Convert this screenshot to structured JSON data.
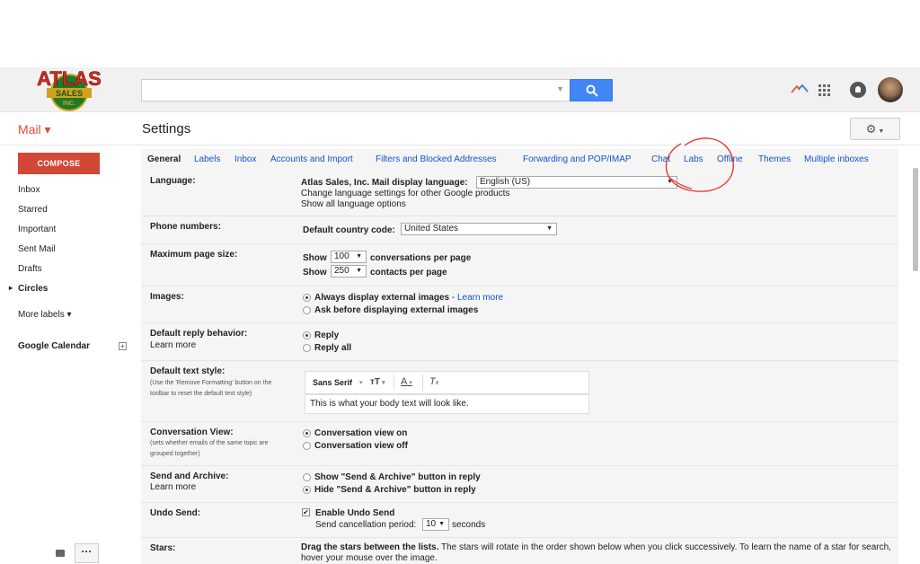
{
  "brand": {
    "logo_text": "ATLAS",
    "logo_sub": "SALES",
    "logo_inc": "INC."
  },
  "app": {
    "mail_label": "Mail ▾",
    "page_title": "Settings"
  },
  "search": {
    "placeholder": ""
  },
  "sidebar": {
    "compose_label": "COMPOSE",
    "items": [
      "Inbox",
      "Starred",
      "Important",
      "Sent Mail",
      "Drafts",
      "Circles"
    ],
    "more_labels": "More labels ▾",
    "calendar": "Google Calendar",
    "more_btn": "···"
  },
  "tabs": [
    "General",
    "Labels",
    "Inbox",
    "Accounts and Import",
    "Filters and Blocked Addresses",
    "Forwarding and POP/IMAP",
    "Chat",
    "Labs",
    "Offline",
    "Themes",
    "Multiple inboxes"
  ],
  "settings": {
    "language": {
      "label": "Language:",
      "prompt": "Atlas Sales, Inc. Mail display language:",
      "value": "English (US)",
      "link1": "Change language settings for other Google products",
      "link2": "Show all language options"
    },
    "phone": {
      "label": "Phone numbers:",
      "prompt": "Default country code:",
      "value": "United States"
    },
    "page_size": {
      "label": "Maximum page size:",
      "show": "Show",
      "conv_value": "100",
      "conv_suffix": "conversations per page",
      "contacts_value": "250",
      "contacts_suffix": "contacts per page"
    },
    "images": {
      "label": "Images:",
      "opt1": "Always display external images",
      "dash": " - ",
      "learn": "Learn more",
      "opt2": "Ask before displaying external images"
    },
    "reply": {
      "label": "Default reply behavior:",
      "learn": "Learn more",
      "opt1": "Reply",
      "opt2": "Reply all"
    },
    "text_style": {
      "label": "Default text style:",
      "sub": "(Use the 'Remove Formatting' button on the toolbar to reset the default text style)",
      "font": "Sans Serif",
      "preview": "This is what your body text will look like."
    },
    "conversation": {
      "label": "Conversation View:",
      "sub": "(sets whether emails of the same topic are grouped together)",
      "opt1": "Conversation view on",
      "opt2": "Conversation view off"
    },
    "send_archive": {
      "label": "Send and Archive:",
      "learn": "Learn more",
      "opt1": "Show \"Send & Archive\" button in reply",
      "opt2": "Hide \"Send & Archive\" button in reply"
    },
    "undo": {
      "label": "Undo Send:",
      "opt": "Enable Undo Send",
      "period": "Send cancellation period:",
      "value": "10",
      "unit": "seconds"
    },
    "stars": {
      "label": "Stars:",
      "bold": "Drag the stars between the lists.",
      "text": " The stars will rotate in the order shown below when you click successively. To learn the name of a star for search, hover your mouse over the image."
    }
  },
  "colors": {
    "compose": "#d14836",
    "link": "#1155cc",
    "search": "#4285f4",
    "annotation": "#e53935"
  }
}
